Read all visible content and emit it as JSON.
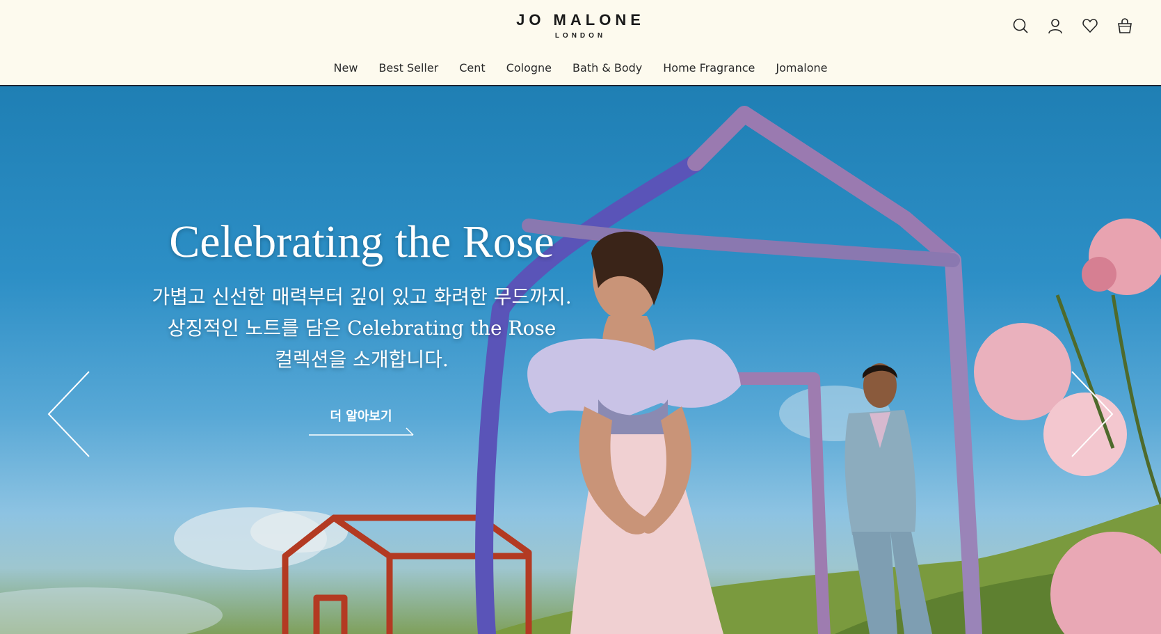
{
  "brand": {
    "name": "Jo Malone",
    "sub": "London"
  },
  "header_icons": [
    "search-icon",
    "account-icon",
    "wishlist-heart-icon",
    "shopping-bag-icon"
  ],
  "nav": {
    "items": [
      "New",
      "Best Seller",
      "Cent",
      "Cologne",
      "Bath & Body",
      "Home Fragrance",
      "Jomalone"
    ]
  },
  "hero": {
    "title": "Celebrating the Rose",
    "desc_line1": "가볍고 신선한 매력부터 깊이 있고 화려한 무드까지.",
    "desc_line2": "상징적인 노트를 담은 Celebrating the Rose",
    "desc_line3": "컬렉션을 소개합니다.",
    "cta": "더 알아보기",
    "arrows": [
      "arrow-left-icon",
      "arrow-right-icon"
    ]
  },
  "colors": {
    "header_bg": "#fdfaee",
    "sky": "#2d8fc6",
    "text_light": "#ffffff"
  }
}
